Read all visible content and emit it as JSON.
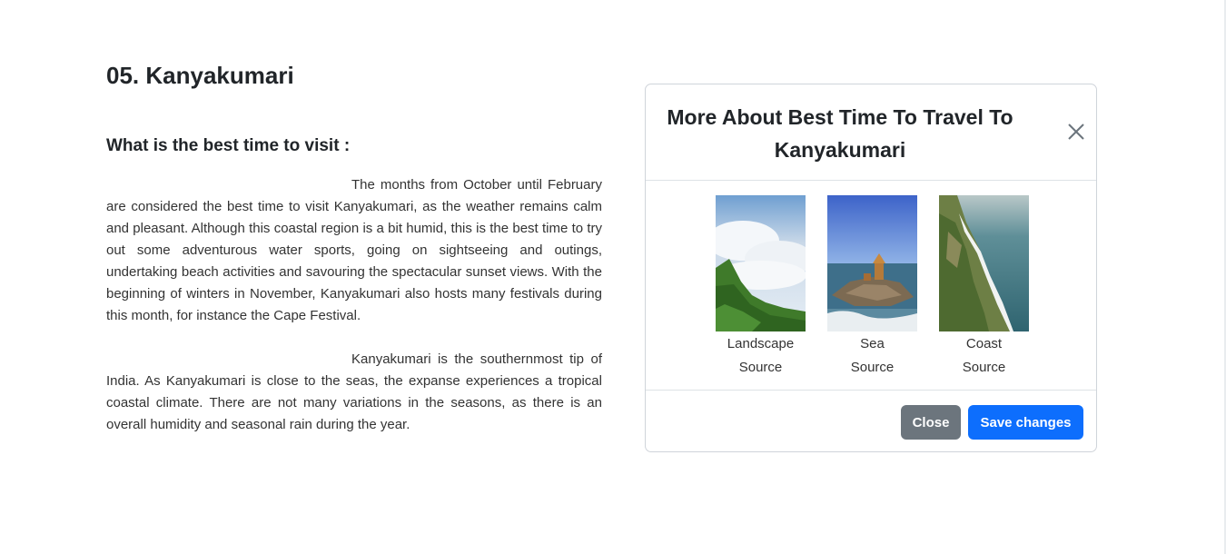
{
  "article": {
    "title": "05. Kanyakumari",
    "subheading": "What is the best time to visit :",
    "paragraphs": [
      "The months from October until February are considered the best time to visit Kanyakumari, as the weather remains calm and pleasant. Although this coastal region is a bit humid, this is the best time to try out some adventurous water sports, going on sightseeing and outings, undertaking beach activities and savouring the spectacular sunset views. With the beginning of winters in November, Kanyakumari also hosts many festivals during this month, for instance the Cape Festival.",
      "Kanyakumari is the southernmost tip of India. As Kanyakumari is close to the seas, the expanse experiences a tropical coastal climate. There are not many variations in the seasons, as there is an overall humidity and seasonal rain during the year."
    ]
  },
  "modal": {
    "title": "More About Best Time To Travel To Kanyakumari",
    "close_icon": "close-icon",
    "images": [
      {
        "caption_line1": "Landscape",
        "caption_line2": "Source",
        "icon": "landscape-photo"
      },
      {
        "caption_line1": "Sea",
        "caption_line2": "Source",
        "icon": "sea-photo"
      },
      {
        "caption_line1": "Coast",
        "caption_line2": "Source",
        "icon": "coast-photo"
      }
    ],
    "close_button": "Close",
    "save_button": "Save changes"
  },
  "colors": {
    "primary": "#0d6efd",
    "secondary": "#6c757d"
  }
}
